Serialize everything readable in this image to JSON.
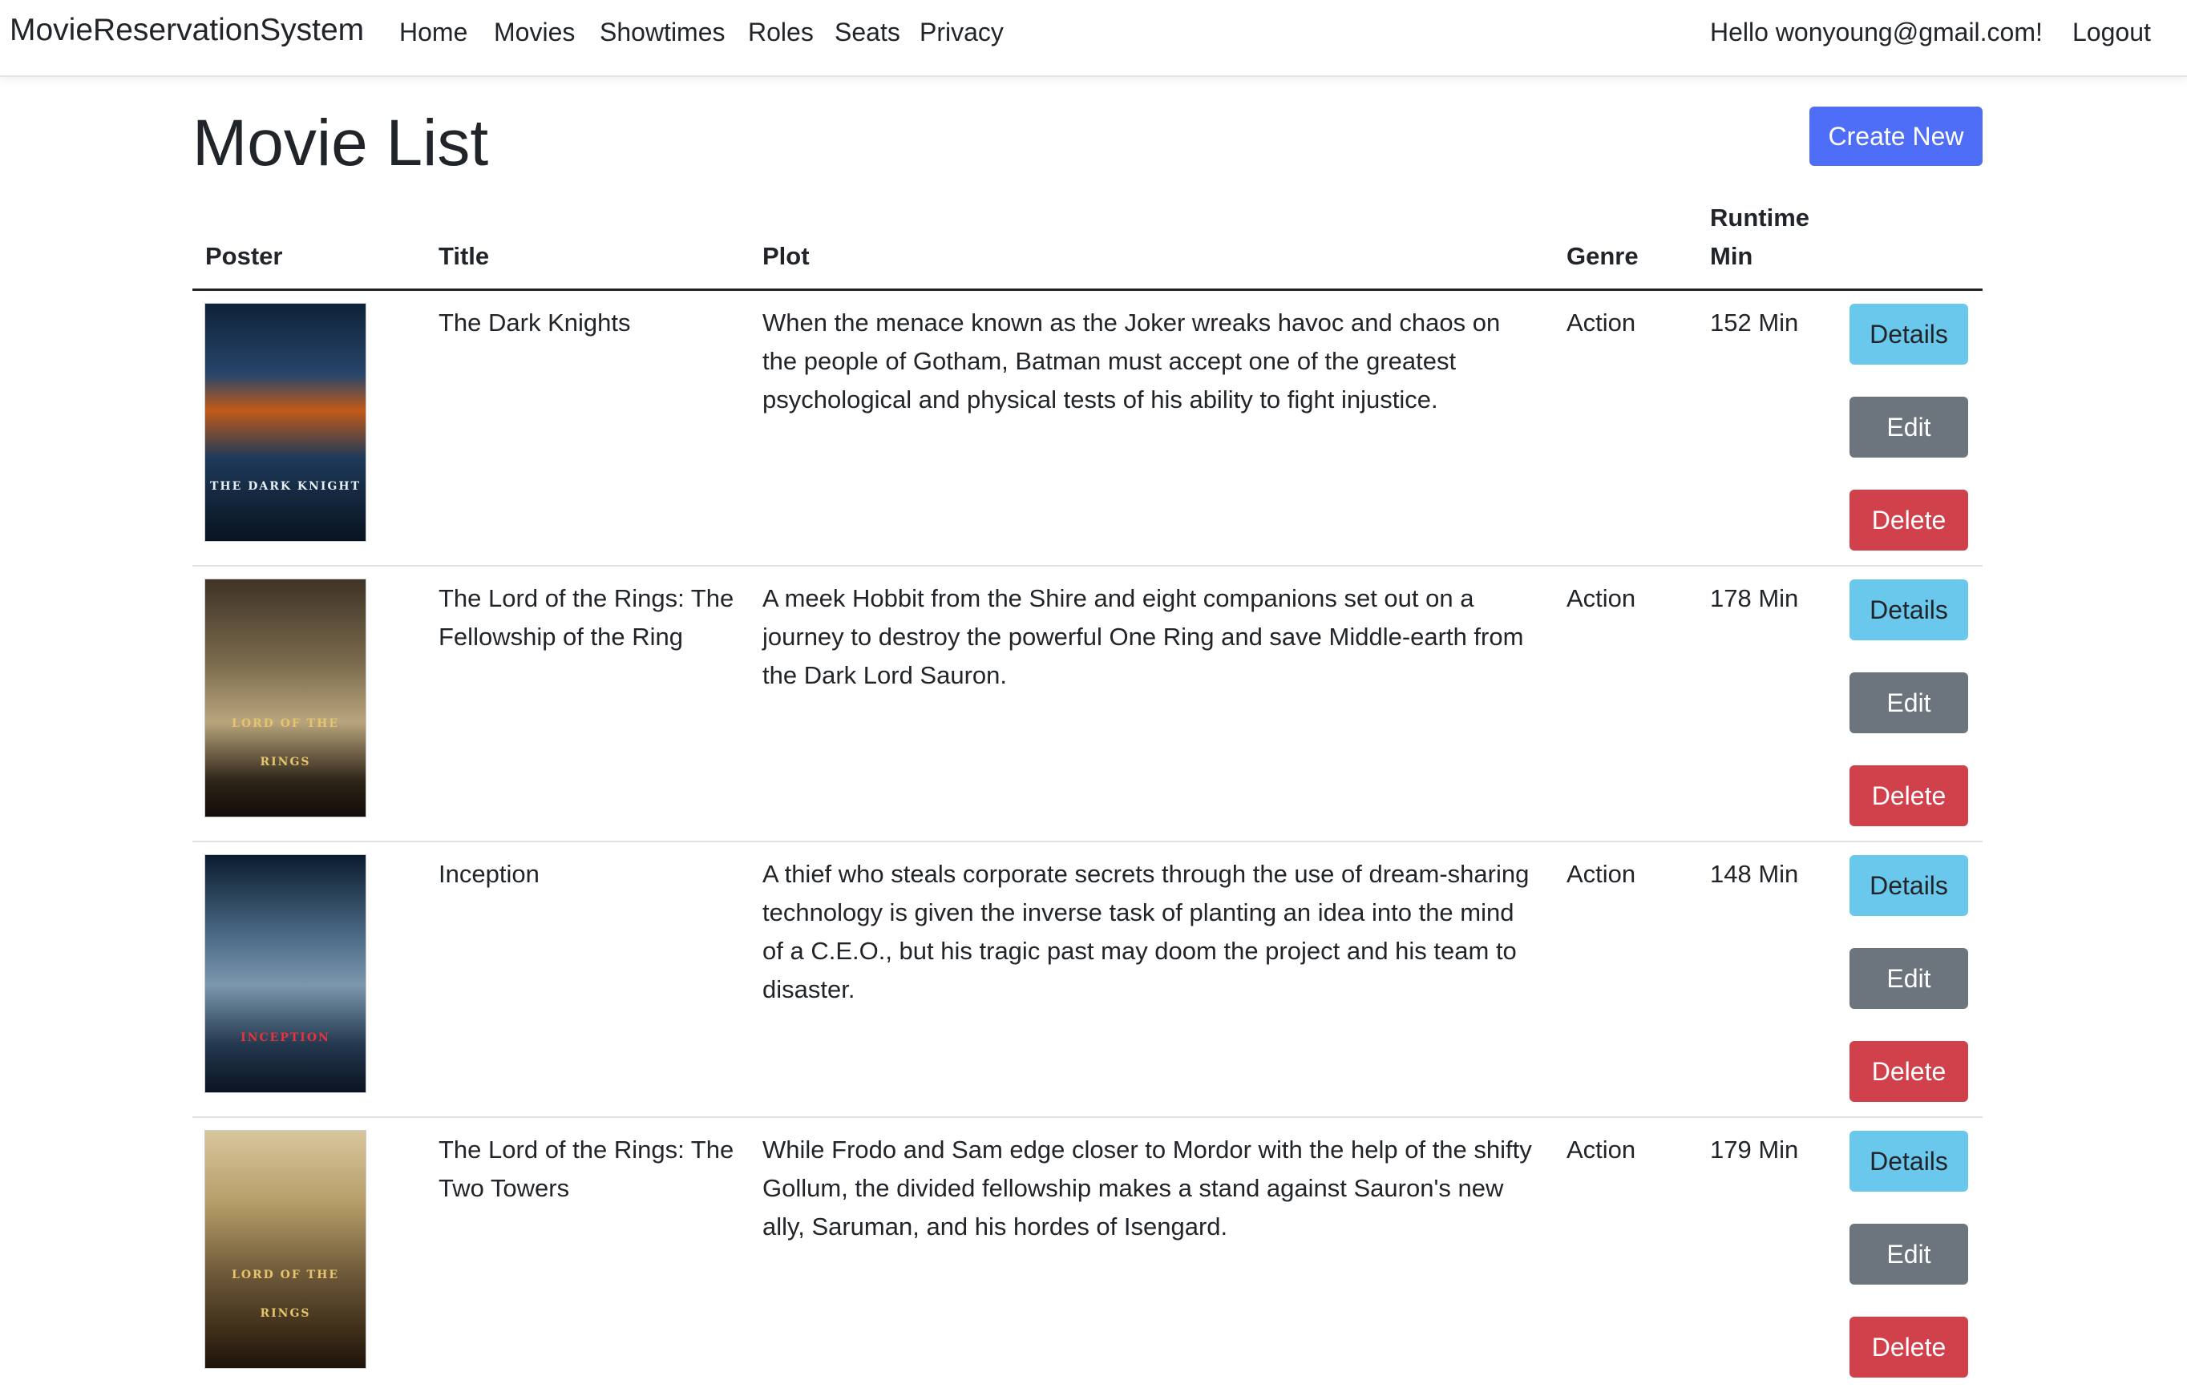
{
  "nav": {
    "brand": "MovieReservationSystem",
    "links": [
      "Home",
      "Movies",
      "Showtimes",
      "Roles",
      "Seats",
      "Privacy"
    ],
    "greeting": "Hello wonyoung@gmail.com!",
    "logout": "Logout"
  },
  "page": {
    "title": "Movie List",
    "create_label": "Create New"
  },
  "table": {
    "headers": {
      "poster": "Poster",
      "title": "Title",
      "plot": "Plot",
      "genre": "Genre",
      "runtime_line1": "Runtime",
      "runtime_line2": "Min"
    },
    "actions": {
      "details": "Details",
      "edit": "Edit",
      "delete": "Delete"
    },
    "rows": [
      {
        "title": "The Dark Knights",
        "plot": "When the menace known as the Joker wreaks havoc and chaos on the people of Gotham, Batman must accept one of the greatest psychological and physical tests of his ability to fight injustice.",
        "genre": "Action",
        "runtime": "152 Min",
        "poster_text": "THE DARK KNIGHT"
      },
      {
        "title": "The Lord of the Rings: The Fellowship of the Ring",
        "plot": "A meek Hobbit from the Shire and eight companions set out on a journey to destroy the powerful One Ring and save Middle-earth from the Dark Lord Sauron.",
        "genre": "Action",
        "runtime": "178 Min",
        "poster_text": "LORD OF THE RINGS"
      },
      {
        "title": "Inception",
        "plot": "A thief who steals corporate secrets through the use of dream-sharing technology is given the inverse task of planting an idea into the mind of a C.E.O., but his tragic past may doom the project and his team to disaster.",
        "genre": "Action",
        "runtime": "148 Min",
        "poster_text": "INCEPTION"
      },
      {
        "title": "The Lord of the Rings: The Two Towers",
        "plot": "While Frodo and Sam edge closer to Mordor with the help of the shifty Gollum, the divided fellowship makes a stand against Sauron's new ally, Saruman, and his hordes of Isengard.",
        "genre": "Action",
        "runtime": "179 Min",
        "poster_text": "LORD OF THE RINGS"
      }
    ]
  },
  "colors": {
    "primary": "#4f6ef7",
    "info": "#6ac8ed",
    "secondary": "#6c757d",
    "danger": "#d0414b"
  }
}
